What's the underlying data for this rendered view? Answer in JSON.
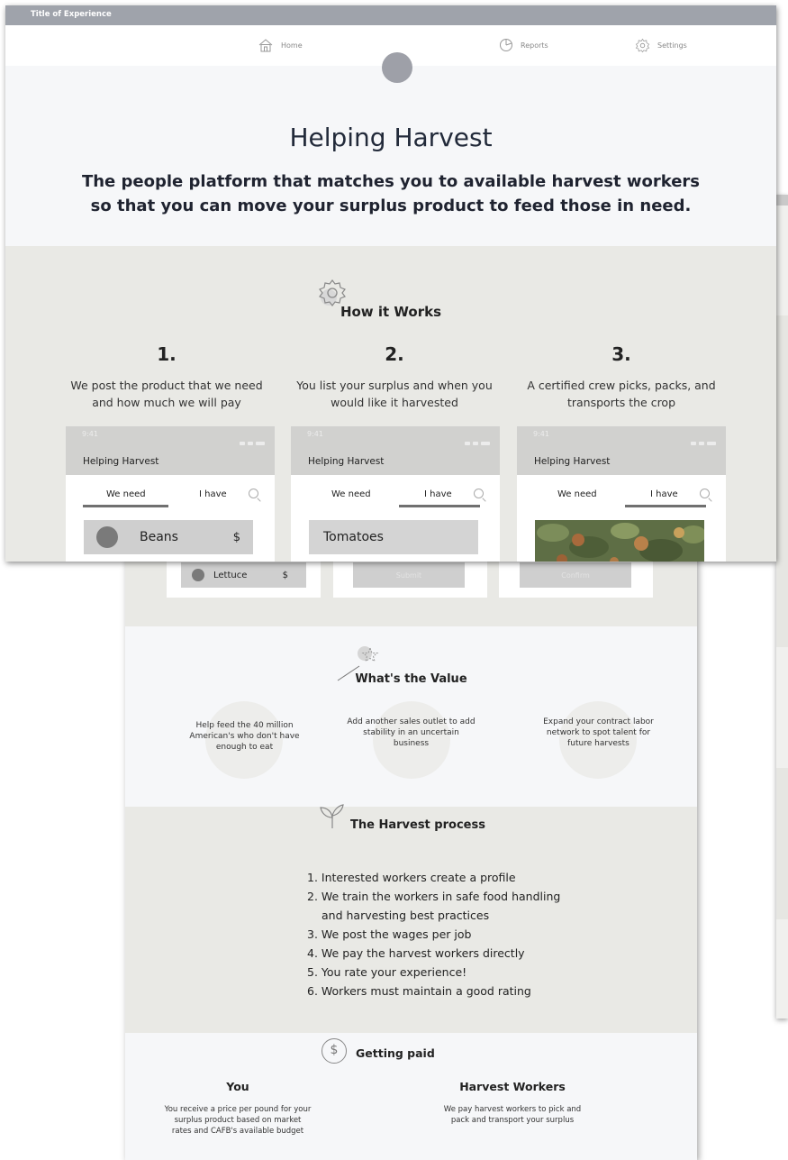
{
  "window": {
    "title": "Title of Experience"
  },
  "nav": {
    "items": [
      {
        "label": "Home",
        "icon": "home-icon"
      },
      {
        "label": "Reports",
        "icon": "pie-chart-icon"
      },
      {
        "label": "Settings",
        "icon": "gear-icon"
      }
    ]
  },
  "hero": {
    "title": "Helping Harvest",
    "subtitle_line1": "The people platform that matches you to available harvest workers",
    "subtitle_line2": "so that you can move your surplus product to feed those in need."
  },
  "how": {
    "title": "How it Works",
    "steps": [
      {
        "num": "1.",
        "line1": "We post the product that we need",
        "line2": "and how much we will pay"
      },
      {
        "num": "2.",
        "line1": "You list your surplus and when you",
        "line2": "would like it harvested"
      },
      {
        "num": "3.",
        "line1": "A certified crew picks, packs, and",
        "line2": "transports the crop"
      }
    ],
    "phones": [
      {
        "time": "9:41",
        "app_title": "Helping Harvest",
        "tab1": "We need",
        "tab2": "I have",
        "active_tab": "We need",
        "row_label": "Beans",
        "row_value": "$",
        "row2_label": "Lettuce",
        "row2_value": "$"
      },
      {
        "time": "9:41",
        "app_title": "Helping Harvest",
        "tab1": "We need",
        "tab2": "I have",
        "active_tab": "I have",
        "row_label": "Tomatoes",
        "button": "Submit"
      },
      {
        "time": "9:41",
        "app_title": "Helping Harvest",
        "tab1": "We need",
        "tab2": "I have",
        "active_tab": "I have",
        "button": "Confirm"
      }
    ]
  },
  "value": {
    "title": "What's the Value",
    "items": [
      {
        "line1": "Help feed the 40 million",
        "line2": "American's who don't have",
        "line3": "enough to eat"
      },
      {
        "line1": "Add another sales outlet to add",
        "line2": "stability in an uncertain",
        "line3": "business"
      },
      {
        "line1": "Expand your contract labor",
        "line2": "network to spot talent for",
        "line3": "future harvests"
      }
    ]
  },
  "harvest": {
    "title": "The Harvest process",
    "steps": [
      "1. Interested workers create a profile",
      "2. We train the workers in safe food handling",
      "and harvesting best practices",
      "3. We post the wages per job",
      "4. We pay the harvest workers directly",
      "5. You rate your experience!",
      "6. Workers must maintain a good rating"
    ]
  },
  "paid": {
    "title": "Getting paid",
    "icon_glyph": "$",
    "you": {
      "title": "You",
      "line1": "You receive a price per pound for your",
      "line2": "surplus product based on market",
      "line3": "rates and  CAFB's available budget"
    },
    "workers": {
      "title": "Harvest Workers",
      "line1": "We pay harvest workers to pick and",
      "line2": "pack and transport your surplus"
    }
  },
  "colors": {
    "title_bar": "#9fa3ab",
    "section_band": "#e9e9e5",
    "page_bg": "#f6f7f9",
    "placeholder_row": "#cfcfcf"
  }
}
